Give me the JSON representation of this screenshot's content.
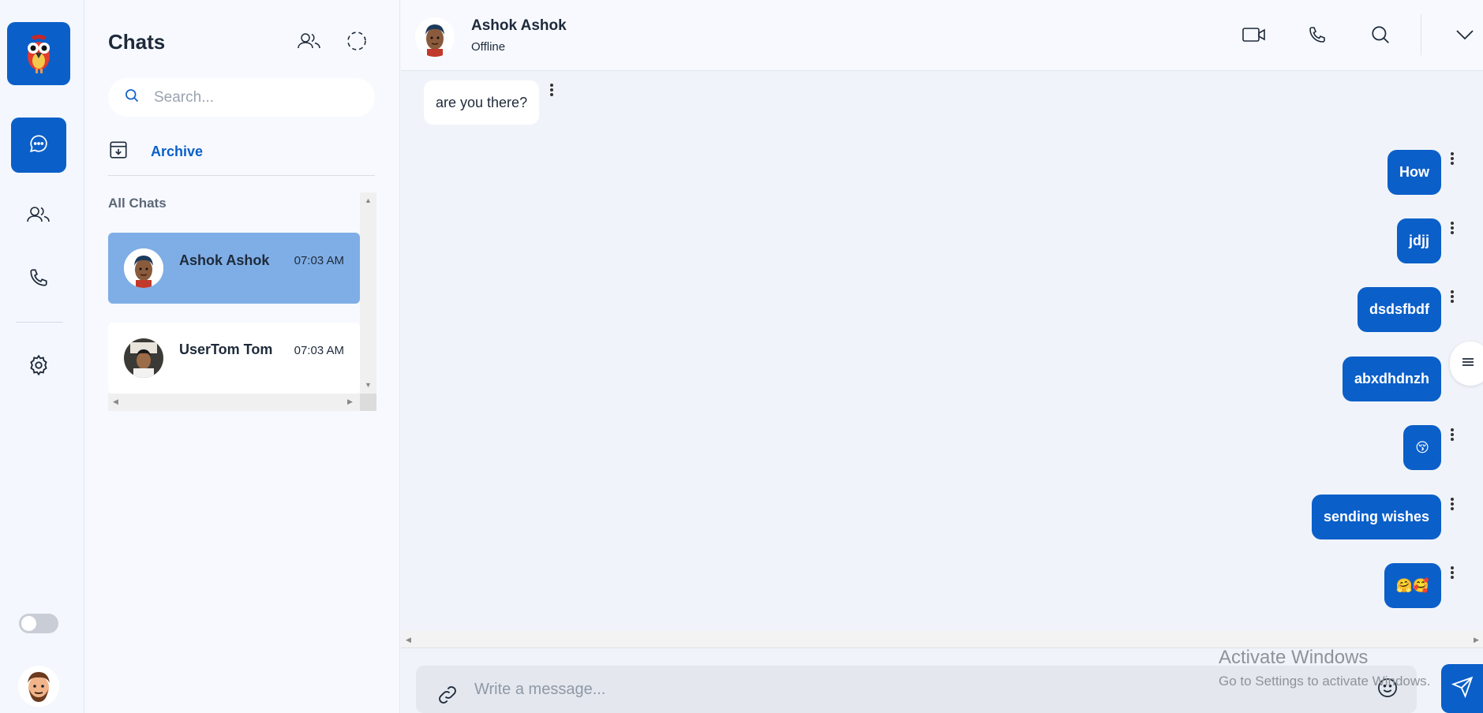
{
  "sidebar": {
    "logo_icon": "parrot-logo-icon",
    "nav": [
      {
        "icon": "chat-bubble-icon",
        "active": true
      },
      {
        "icon": "users-icon",
        "active": false
      },
      {
        "icon": "phone-icon",
        "active": false
      },
      {
        "icon": "gear-icon",
        "active": false
      }
    ],
    "theme_toggle": "off"
  },
  "chats_panel": {
    "title": "Chats",
    "search_placeholder": "Search...",
    "archive_label": "Archive",
    "section_label": "All Chats",
    "items": [
      {
        "name": "Ashok Ashok",
        "time": "07:03 AM",
        "selected": true
      },
      {
        "name": "UserTom Tom",
        "time": "07:03 AM",
        "selected": false
      }
    ]
  },
  "conversation": {
    "contact_name": "Ashok Ashok",
    "contact_status": "Offline",
    "incoming": [
      {
        "text": "are you there?"
      }
    ],
    "outgoing": [
      {
        "text": "How"
      },
      {
        "text": "jdjj"
      },
      {
        "text": "dsdsfbdf"
      },
      {
        "text": "abxdhdnzh"
      },
      {
        "text": "😚"
      },
      {
        "text": "sending wishes"
      },
      {
        "text": "🤗🥰"
      }
    ],
    "composer_placeholder": "Write a message..."
  },
  "watermark": {
    "line1": "Activate Windows",
    "line2": "Go to Settings to activate Windows."
  },
  "colors": {
    "accent": "#0b5fc9",
    "selected_row": "#7faee6",
    "background": "#f0f4fa"
  }
}
